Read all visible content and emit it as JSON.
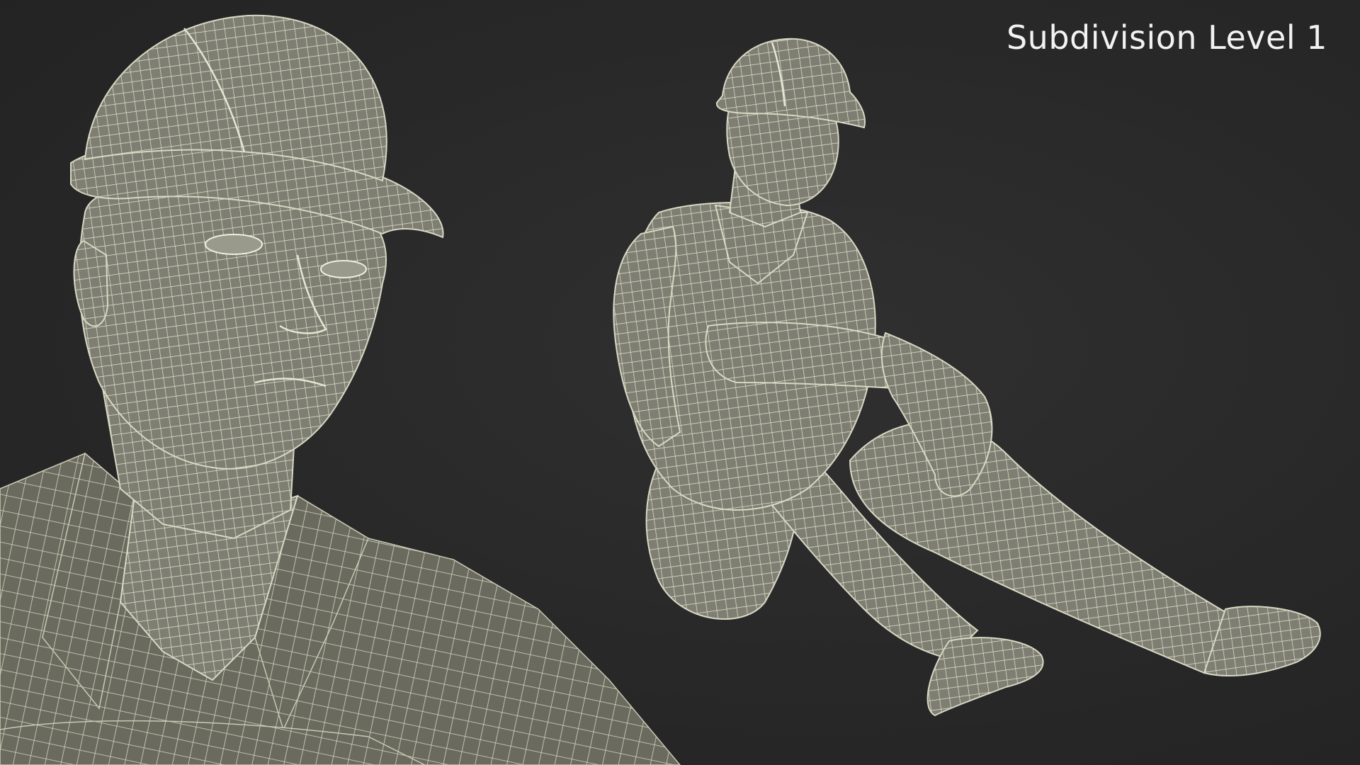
{
  "overlay": {
    "title": "Subdivision Level 1"
  },
  "colors": {
    "background": "#2a2a2a",
    "mesh_fill": "#7d7d70",
    "mesh_lines": "#e6e6d4",
    "label_text": "#f2f2f2"
  },
  "views": [
    {
      "name": "closeup-head-view",
      "subject": "worker-hard-hat-closeup"
    },
    {
      "name": "full-body-seated-view",
      "subject": "worker-seated-full-body"
    }
  ]
}
